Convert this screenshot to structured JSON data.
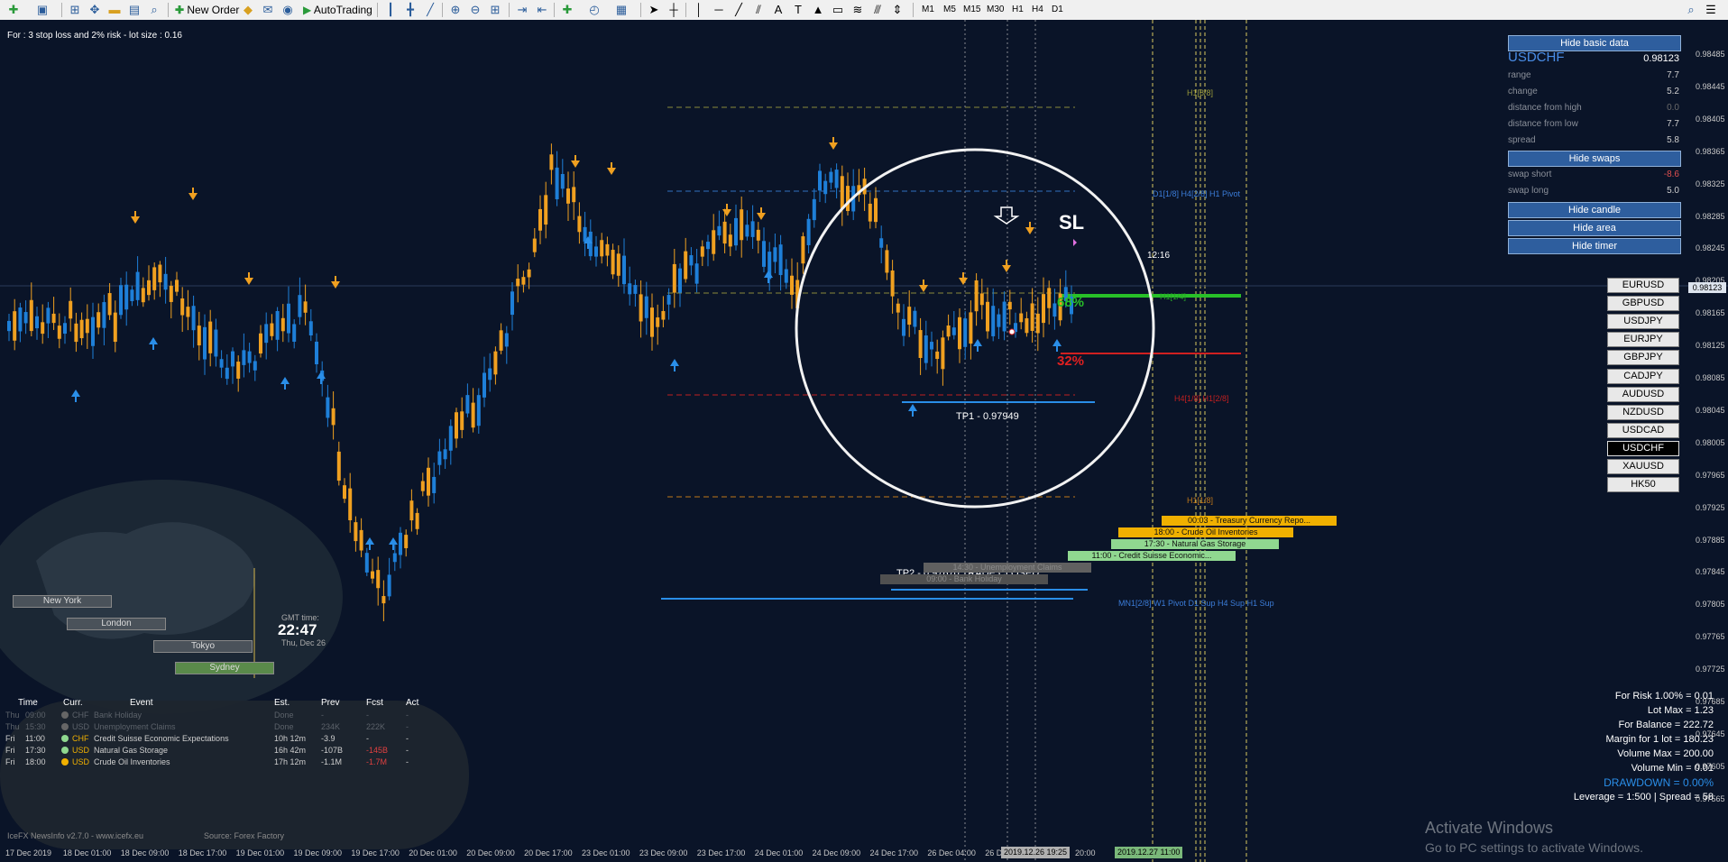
{
  "toolbar": {
    "new_order": "New Order",
    "autotrading": "AutoTrading",
    "timeframes": [
      "M1",
      "M5",
      "M15",
      "M30",
      "H1",
      "H4",
      "D1"
    ]
  },
  "chart": {
    "info_line": "For : 3 stop loss and 2% risk - lot size : 0.16",
    "price_scale": [
      "0.98485",
      "0.98445",
      "0.98405",
      "0.98365",
      "0.98325",
      "0.98285",
      "0.98245",
      "0.98205",
      "0.98165",
      "0.98125",
      "0.98085",
      "0.98045",
      "0.98005",
      "0.97965",
      "0.97925",
      "0.97885",
      "0.97845",
      "0.97805",
      "0.97765",
      "0.97725",
      "0.97685",
      "0.97645",
      "0.97605",
      "0.97565"
    ],
    "current_price": "0.98123",
    "time_scale": [
      "17 Dec 2019",
      "18 Dec 01:00",
      "18 Dec 09:00",
      "18 Dec 17:00",
      "19 Dec 01:00",
      "19 Dec 09:00",
      "19 Dec 17:00",
      "20 Dec 01:00",
      "20 Dec 09:00",
      "20 Dec 17:00",
      "23 Dec 01:00",
      "23 Dec 09:00",
      "23 Dec 17:00",
      "24 Dec 01:00",
      "24 Dec 09:00",
      "24 Dec 17:00",
      "26 Dec 04:00",
      "26 D"
    ],
    "time_box_1": "2019.12.26 19:25",
    "time_box_1_suffix": "20:00",
    "time_box_2": "2019.12.27 11:00",
    "labels": {
      "sl": "SL",
      "tp1": "TP1 - 0.97949",
      "tp2": "TP2 - 0.97670 TRADE CLOSED",
      "pct_green": "68%",
      "pct_red": "32%",
      "timer": "12:16",
      "h1_top": "H1[8/8]",
      "pivot_blue": "D1[1/8] H4[2/8] H1 Pivot",
      "h4_red": "H4[1/8] H1[2/8]",
      "h1_orange": "H1[1/8]",
      "mn1_blue": "MN1[2/8] W1 Pivot D1 Sup H4 Sup H1 Sup",
      "green_line_label": "H1[1/4]",
      "faded_label_1": "14:30 - Unemployment Claims",
      "faded_label_2": "09:00 - Bank Holiday"
    },
    "colors": {
      "bull": "#1e7fd8",
      "bear": "#f0a020",
      "background": "#0a1428"
    }
  },
  "panel": {
    "hide_basic_data": "Hide basic data",
    "symbol": "USDCHF",
    "price": "0.98123",
    "rows": [
      {
        "label": "range",
        "value": "7.7"
      },
      {
        "label": "change",
        "value": "5.2"
      },
      {
        "label": "distance from high",
        "value": "0.0"
      },
      {
        "label": "distance from low",
        "value": "7.7"
      },
      {
        "label": "spread",
        "value": "5.8"
      }
    ],
    "hide_swaps": "Hide swaps",
    "swap_short_label": "swap short",
    "swap_short_value": "-8.6",
    "swap_long_label": "swap long",
    "swap_long_value": "5.0",
    "hide_candle": "Hide candle",
    "hide_area": "Hide area",
    "hide_timer": "Hide timer"
  },
  "symbols": [
    "EURUSD",
    "GBPUSD",
    "USDJPY",
    "EURJPY",
    "GBPJPY",
    "CADJPY",
    "AUDUSD",
    "NZDUSD",
    "USDCAD",
    "USDCHF",
    "XAUUSD",
    "HK50"
  ],
  "active_symbol": "USDCHF",
  "sessions": {
    "cities": [
      "New York",
      "London",
      "Tokyo",
      "Sydney"
    ],
    "gmt_label": "GMT time:",
    "gmt_time": "22:47",
    "gmt_date": "Thu, Dec 26"
  },
  "news_table": {
    "headers": [
      "Time",
      "Curr.",
      "Event",
      "Est.",
      "Prev",
      "Fcst",
      "Act"
    ],
    "rows": [
      {
        "day": "Thu",
        "time": "09:00",
        "curr": "CHF",
        "event": "Bank Holiday",
        "est": "Done",
        "prev": "-",
        "fcst": "-",
        "act": "-",
        "dot": "#666666",
        "faded": true,
        "fcst_red": false
      },
      {
        "day": "Thu",
        "time": "15:30",
        "curr": "USD",
        "event": "Unemployment Claims",
        "est": "Done",
        "prev": "234K",
        "fcst": "222K",
        "act": "-",
        "dot": "#666666",
        "faded": true,
        "fcst_red": false
      },
      {
        "day": "Fri",
        "time": "11:00",
        "curr": "CHF",
        "event": "Credit Suisse Economic Expectations",
        "est": "10h 12m",
        "prev": "-3.9",
        "fcst": "-",
        "act": "-",
        "dot": "#8fd88f",
        "faded": false,
        "fcst_red": false
      },
      {
        "day": "Fri",
        "time": "17:30",
        "curr": "USD",
        "event": "Natural Gas Storage",
        "est": "16h 42m",
        "prev": "-107B",
        "fcst": "-145B",
        "act": "-",
        "dot": "#8fd88f",
        "faded": false,
        "fcst_red": true
      },
      {
        "day": "Fri",
        "time": "18:00",
        "curr": "USD",
        "event": "Crude Oil Inventories",
        "est": "17h 12m",
        "prev": "-1.1M",
        "fcst": "-1.7M",
        "act": "-",
        "dot": "#f0b000",
        "faded": false,
        "fcst_red": true
      }
    ],
    "footer_left": "IceFX NewsInfo v2.7.0 - www.icefx.eu",
    "footer_right": "Source: Forex Factory"
  },
  "news_boxes": [
    {
      "text": "00:03 - Treasury Currency Repo...",
      "color": "#f0b000"
    },
    {
      "text": "18:00 - Crude Oil Inventories",
      "color": "#f0b000"
    },
    {
      "text": "17:30 - Natural Gas Storage",
      "color": "#90d890"
    },
    {
      "text": "11:00 - Credit Suisse Economic...",
      "color": "#90d890"
    }
  ],
  "risk_info": [
    "For Risk 1.00% = 0.01",
    "Lot Max = 1.23",
    "For Balance = 222.72",
    "Margin for 1 lot = 180.23",
    "Volume Max = 200.00",
    "Volume Min = 0.01"
  ],
  "drawdown": "DRAWDOWN = 0.00%",
  "leverage": "Leverage = 1:500 | Spread = 58",
  "watermark": {
    "title": "Activate Windows",
    "subtitle": "Go to PC settings to activate Windows."
  }
}
